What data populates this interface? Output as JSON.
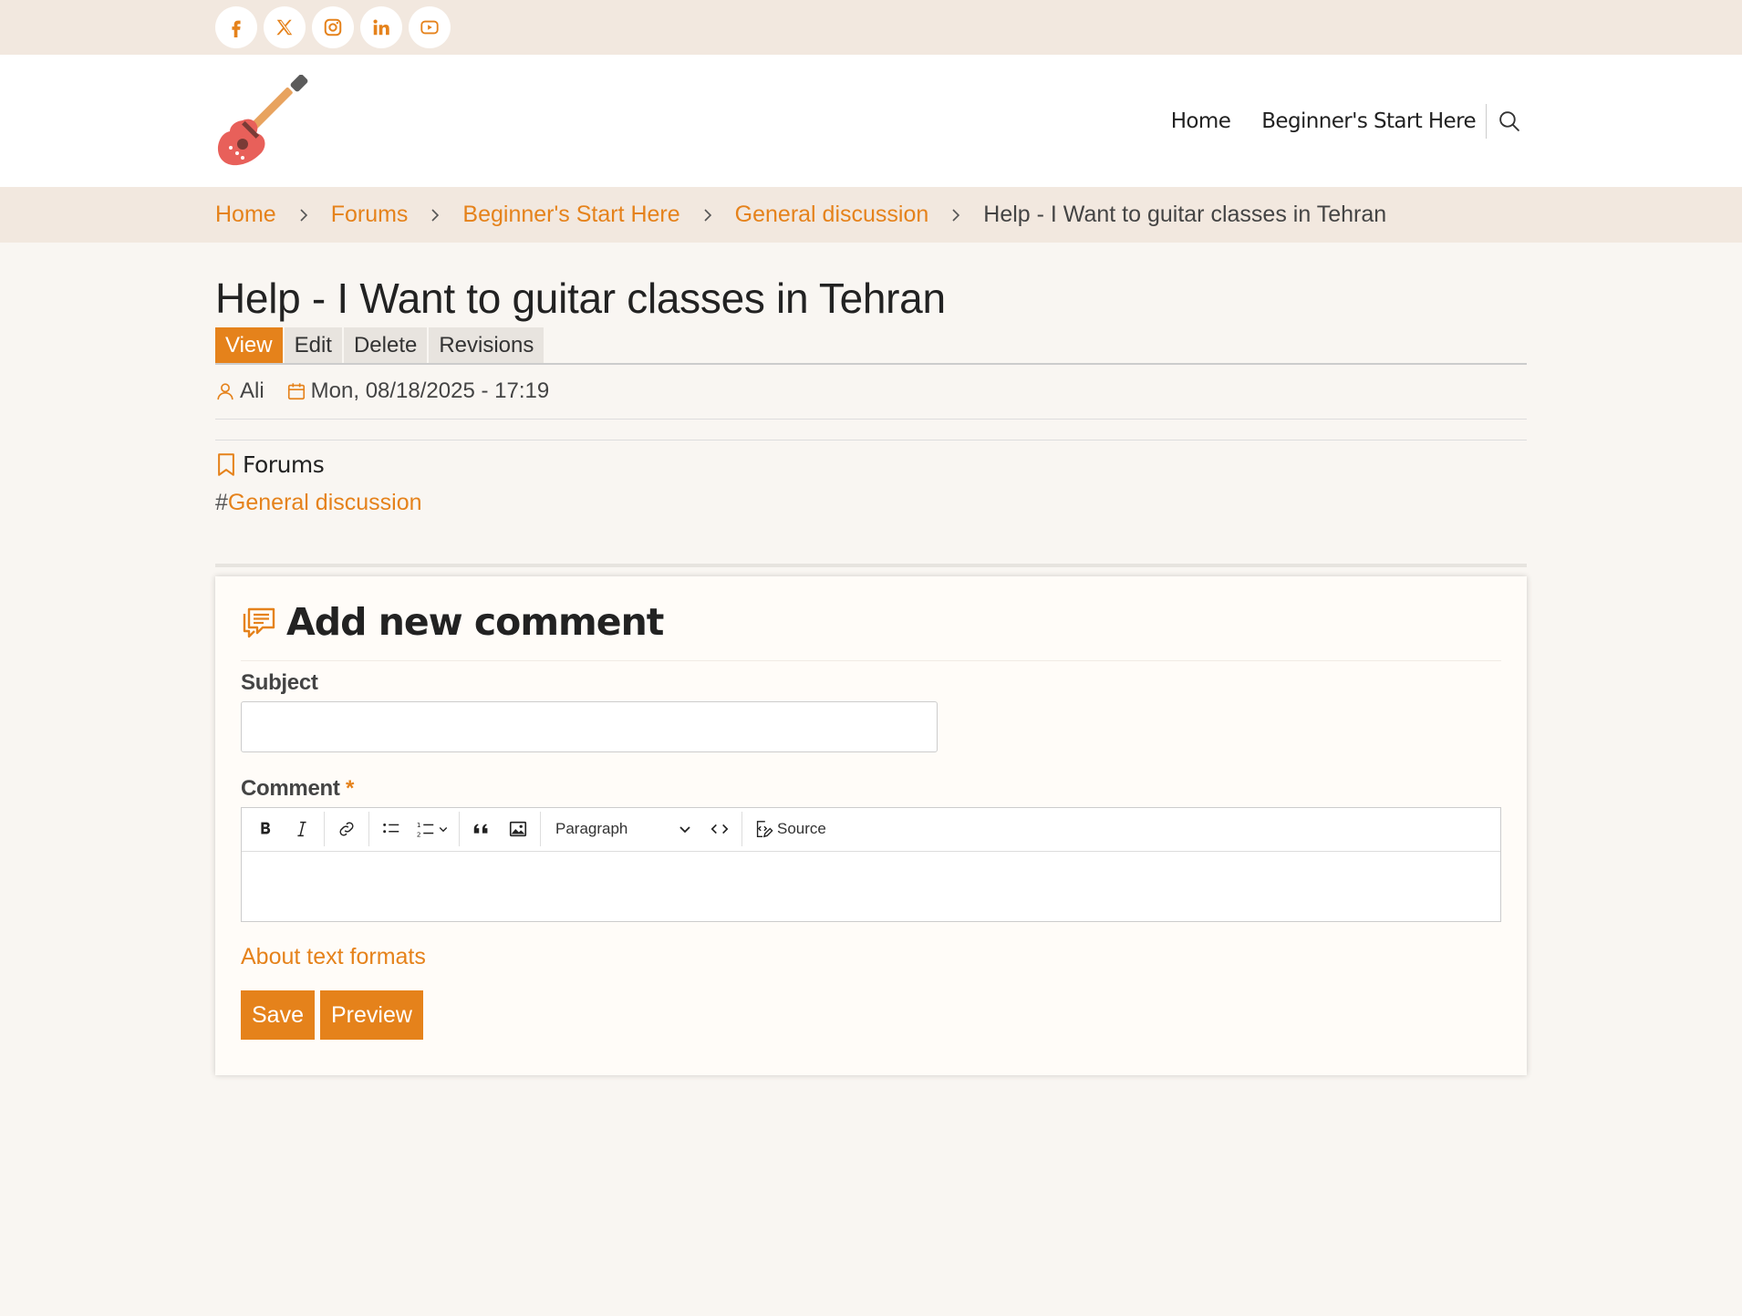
{
  "social": [
    "facebook-icon",
    "x-twitter-icon",
    "instagram-icon",
    "linkedin-icon",
    "youtube-icon"
  ],
  "nav": {
    "home": "Home",
    "beginners": "Beginner's Start Here"
  },
  "breadcrumb": {
    "home": "Home",
    "forums": "Forums",
    "beginners": "Beginner's Start Here",
    "general": "General discussion",
    "current": "Help - I Want to guitar classes in Tehran"
  },
  "page": {
    "title": "Help - I Want to guitar classes in Tehran",
    "tabs": [
      "View",
      "Edit",
      "Delete",
      "Revisions"
    ],
    "author": "Ali",
    "date": "Mon, 08/18/2025 - 17:19",
    "category_title": "Forums",
    "tag_hash": "#",
    "tag": "General discussion"
  },
  "comment_form": {
    "title": "Add new comment",
    "subject_label": "Subject",
    "subject_value": "",
    "comment_label": "Comment",
    "required_mark": "*",
    "paragraph_select": "Paragraph",
    "source_label": "Source",
    "formats_link": "About text formats",
    "save": "Save",
    "preview": "Preview"
  },
  "colors": {
    "accent": "#e5821b",
    "topbar": "#f2e8df",
    "page_bg": "#f9f6f2"
  }
}
